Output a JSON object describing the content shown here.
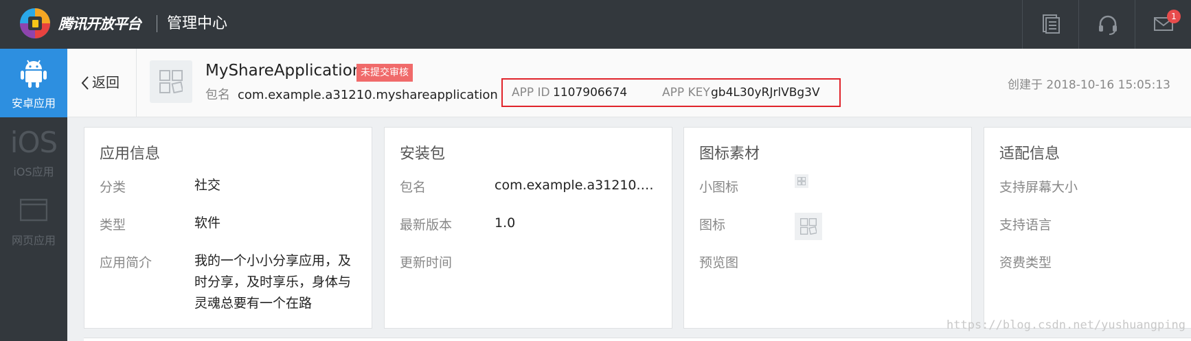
{
  "topbar": {
    "brand": "腾讯开放平台",
    "title": "管理中心",
    "notification_count": "1",
    "icons": [
      "document-icon",
      "headset-icon",
      "mail-icon"
    ]
  },
  "sidebar": {
    "items": [
      {
        "label": "安卓应用",
        "icon": "android-icon",
        "active": true
      },
      {
        "label": "iOS应用",
        "icon_text": "iOS",
        "active": false
      },
      {
        "label": "网页应用",
        "icon": "browser-window-icon",
        "active": false
      }
    ]
  },
  "app_header": {
    "back_label": "返回",
    "app_name": "MyShareApplication",
    "status_tag": "未提交审核",
    "package_label": "包名",
    "package_name": "com.example.a31210.myshareapplication",
    "app_id_label": "APP ID",
    "app_id": "1107906674",
    "app_key_label": "APP KEY",
    "app_key": "gb4L30yRJrlVBg3V",
    "created": "创建于 2018-10-16 15:05:13"
  },
  "cards": {
    "app_info": {
      "title": "应用信息",
      "category_label": "分类",
      "category": "社交",
      "type_label": "类型",
      "type": "软件",
      "intro_label": "应用简介",
      "intro": "我的一个小小分享应用，及时分享，及时享乐，身体与灵魂总要有一个在路"
    },
    "package": {
      "title": "安装包",
      "pkg_label": "包名",
      "pkg_value": "com.example.a31210.m…",
      "version_label": "最新版本",
      "version": "1.0",
      "update_label": "更新时间"
    },
    "icons": {
      "title": "图标素材",
      "small_icon_label": "小图标",
      "icon_label": "图标",
      "preview_label": "预览图"
    },
    "adapt": {
      "title": "适配信息",
      "screen_label": "支持屏幕大小",
      "language_label": "支持语言",
      "fee_label": "资费类型"
    }
  },
  "watermark": "https://blog.csdn.net/yushuangping",
  "colors": {
    "topbar": "#33383d",
    "active_sidebar": "#2d8fe0",
    "status_tag": "#f06a6a",
    "highlight_box": "#e0232a"
  }
}
